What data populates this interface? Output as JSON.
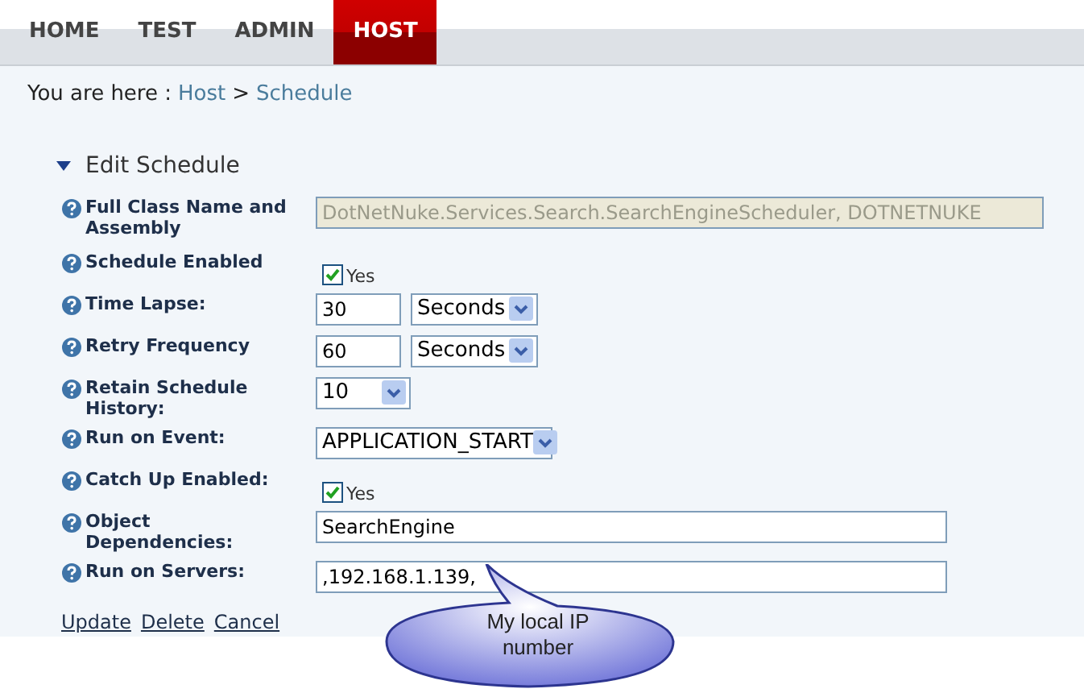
{
  "nav": [
    {
      "label": "HOME",
      "selected": false
    },
    {
      "label": "TEST",
      "selected": false
    },
    {
      "label": "ADMIN",
      "selected": false
    },
    {
      "label": "HOST",
      "selected": true
    }
  ],
  "breadcrumb": {
    "prefix": "You are here :",
    "links": [
      "Host",
      "Schedule"
    ],
    "separator": ">"
  },
  "section": {
    "title": "Edit Schedule",
    "expanded": true
  },
  "rows": [
    {
      "label": "Full Class Name and Assembly",
      "kind": "readonly",
      "value": "DotNetNuke.Services.Search.SearchEngineScheduler, DOTNETNUKE"
    },
    {
      "label": "Schedule Enabled",
      "kind": "checkbox",
      "checked": true,
      "option": "Yes"
    },
    {
      "label": "Time Lapse:",
      "kind": "interval",
      "value": "30",
      "unit": "Seconds"
    },
    {
      "label": "Retry Frequency",
      "kind": "interval",
      "value": "60",
      "unit": "Seconds"
    },
    {
      "label": "Retain Schedule History:",
      "kind": "select",
      "value": "10"
    },
    {
      "label": "Run on Event:",
      "kind": "select",
      "value": "APPLICATION_START"
    },
    {
      "label": "Catch Up Enabled:",
      "kind": "checkbox",
      "checked": true,
      "option": "Yes"
    },
    {
      "label": "Object Dependencies:",
      "kind": "text",
      "value": "SearchEngine"
    },
    {
      "label": "Run on Servers:",
      "kind": "text",
      "value": ",192.168.1.139,"
    }
  ],
  "actions": [
    "Update",
    "Delete",
    "Cancel"
  ],
  "callout": {
    "text": "My local IP number"
  }
}
